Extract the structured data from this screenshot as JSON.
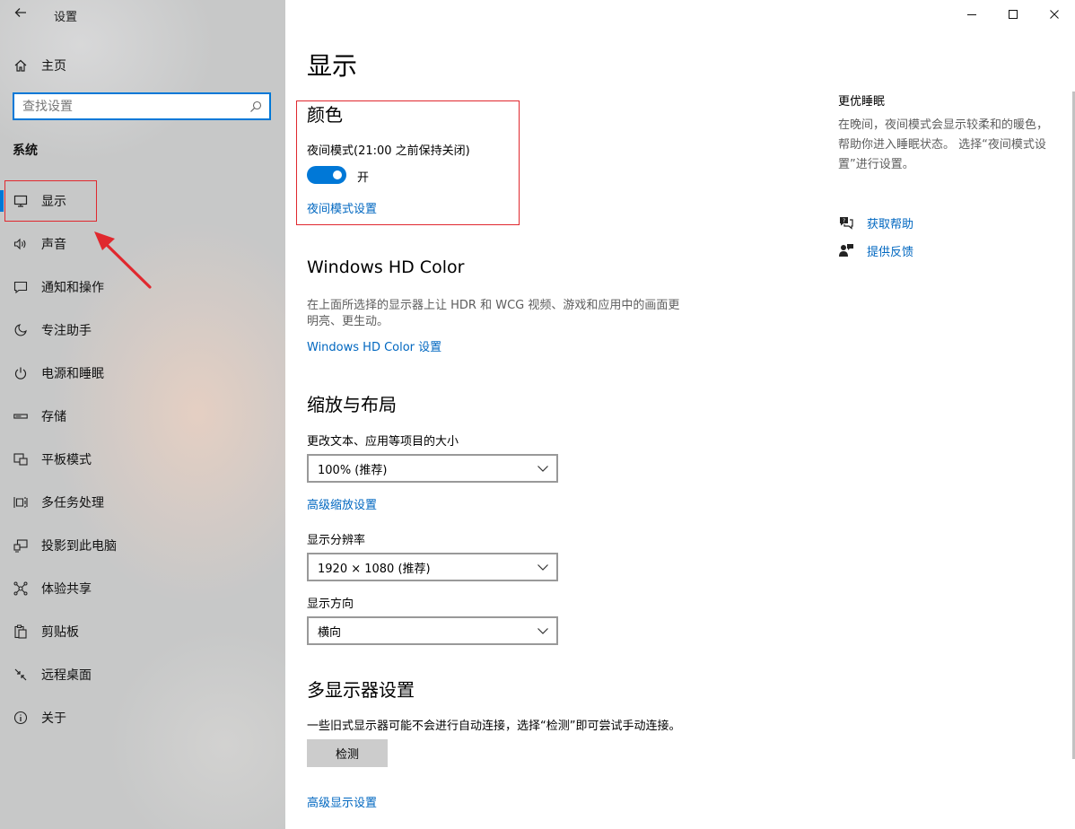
{
  "window": {
    "title": "设置",
    "controls": [
      "minimize",
      "maximize",
      "close"
    ]
  },
  "sidebar": {
    "home_label": "主页",
    "search_placeholder": "查找设置",
    "section_label": "系统",
    "items": [
      {
        "label": "显示",
        "icon": "monitor-icon",
        "active": true
      },
      {
        "label": "声音",
        "icon": "speaker-icon"
      },
      {
        "label": "通知和操作",
        "icon": "message-icon"
      },
      {
        "label": "专注助手",
        "icon": "moon-icon"
      },
      {
        "label": "电源和睡眠",
        "icon": "power-icon"
      },
      {
        "label": "存储",
        "icon": "storage-icon"
      },
      {
        "label": "平板模式",
        "icon": "tablet-icon"
      },
      {
        "label": "多任务处理",
        "icon": "multitask-icon"
      },
      {
        "label": "投影到此电脑",
        "icon": "project-icon"
      },
      {
        "label": "体验共享",
        "icon": "share-icon"
      },
      {
        "label": "剪贴板",
        "icon": "clipboard-icon"
      },
      {
        "label": "远程桌面",
        "icon": "remote-icon"
      },
      {
        "label": "关于",
        "icon": "info-icon"
      }
    ]
  },
  "main": {
    "title": "显示",
    "color": {
      "heading": "颜色",
      "night_mode_label": "夜间模式(21:00 之前保持关闭)",
      "toggle_state": "开",
      "toggle_on": true,
      "settings_link": "夜间模式设置"
    },
    "hdr": {
      "heading": "Windows HD Color",
      "desc_line1": "在上面所选择的显示器上让 HDR 和 WCG 视频、游戏和应用中的画面更",
      "desc_line2": "明亮、更生动。",
      "link": "Windows HD Color 设置"
    },
    "scale": {
      "heading": "缩放与布局",
      "size_label": "更改文本、应用等项目的大小",
      "size_value": "100% (推荐)",
      "advanced_link": "高级缩放设置",
      "resolution_label": "显示分辨率",
      "resolution_value": "1920 × 1080 (推荐)",
      "orientation_label": "显示方向",
      "orientation_value": "横向"
    },
    "multi": {
      "heading": "多显示器设置",
      "desc": "一些旧式显示器可能不会进行自动连接，选择“检测”即可尝试手动连接。",
      "detect_button": "检测",
      "advanced_link": "高级显示设置"
    }
  },
  "right_panel": {
    "title": "更优睡眠",
    "desc": "在晚间，夜间模式会显示较柔和的暖色，帮助你进入睡眠状态。 选择“夜间模式设置”进行设置。",
    "help_link": "获取帮助",
    "feedback_link": "提供反馈"
  },
  "colors": {
    "accent": "#0078d7",
    "link": "#0067c0",
    "annotation": "#e0282e"
  }
}
